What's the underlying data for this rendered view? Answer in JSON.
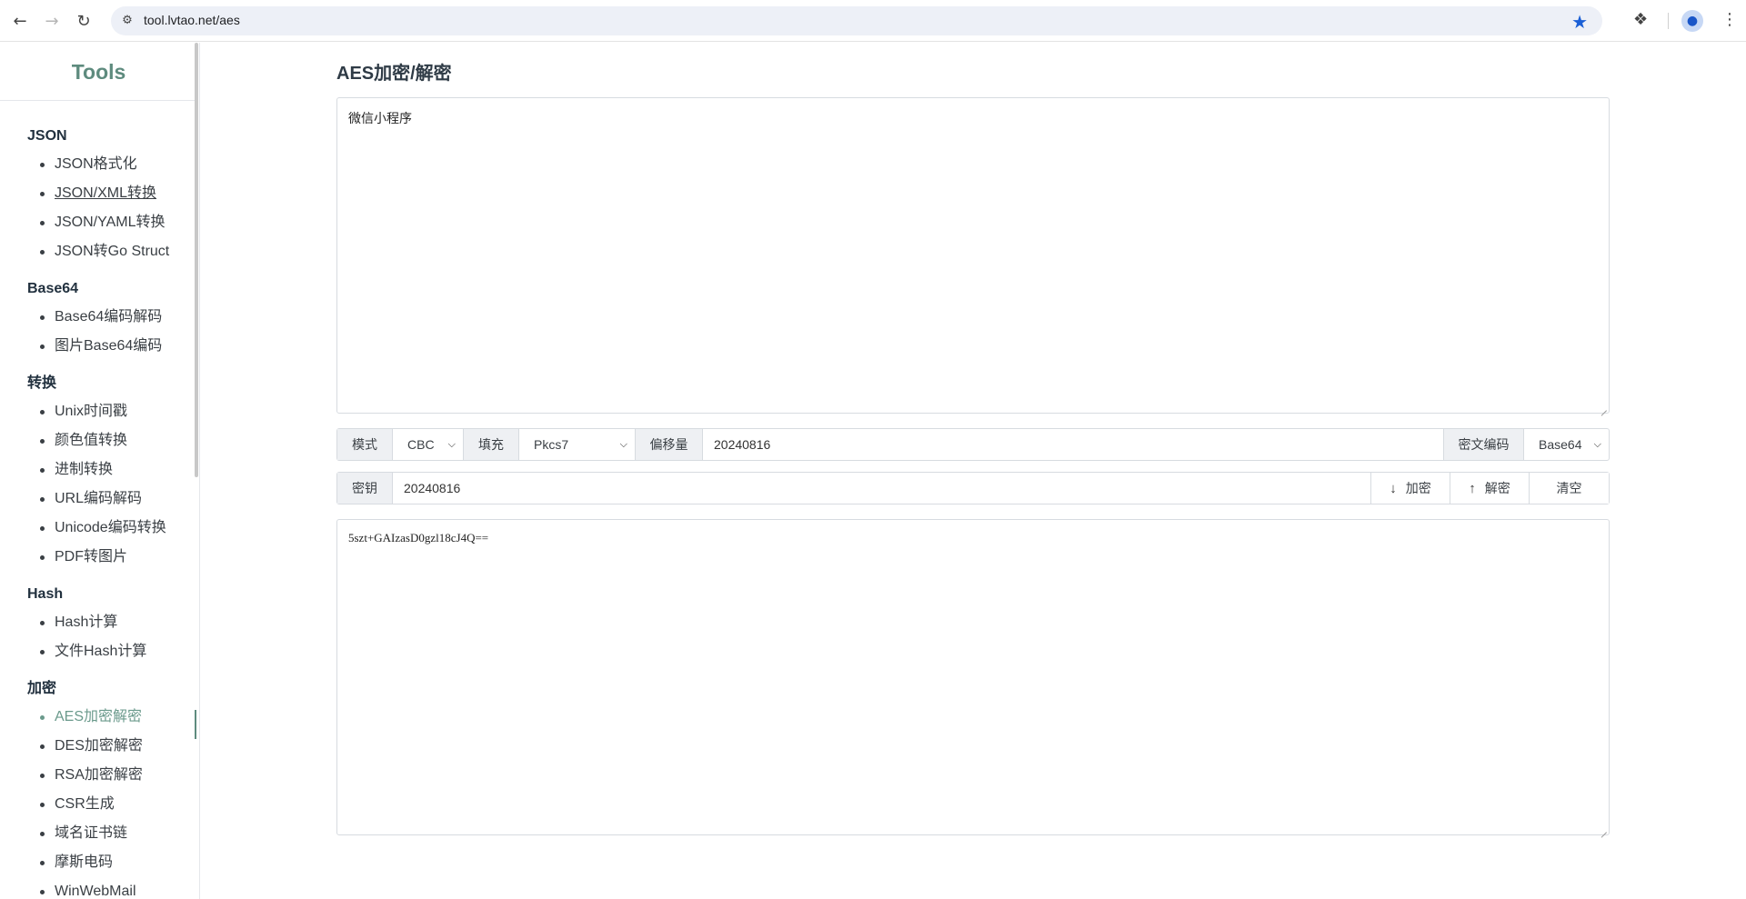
{
  "browser": {
    "url": "tool.lvtao.net/aes",
    "icons": {
      "back": "arrow-left-icon",
      "forward": "arrow-right-icon",
      "reload": "reload-icon",
      "site_info": "tune-icon",
      "bookmark": "star-icon",
      "extensions": "puzzle-icon",
      "profile": "person-icon",
      "menu": "kebab-menu-icon"
    }
  },
  "sidebar": {
    "brand": "Tools",
    "groups": [
      {
        "title": "JSON",
        "items": [
          "JSON格式化",
          "JSON/XML转换",
          "JSON/YAML转换",
          "JSON转Go Struct"
        ]
      },
      {
        "title": "Base64",
        "items": [
          "Base64编码解码",
          "图片Base64编码"
        ]
      },
      {
        "title": "转换",
        "items": [
          "Unix时间戳",
          "颜色值转换",
          "进制转换",
          "URL编码解码",
          "Unicode编码转换",
          "PDF转图片"
        ]
      },
      {
        "title": "Hash",
        "items": [
          "Hash计算",
          "文件Hash计算"
        ]
      },
      {
        "title": "加密",
        "items": [
          "AES加密解密",
          "DES加密解密",
          "RSA加密解密",
          "CSR生成",
          "域名证书链",
          "摩斯电码",
          "WinWebMail"
        ]
      }
    ]
  },
  "main": {
    "title": "AES加密/解密",
    "input_text": "微信小程序",
    "options": {
      "mode_label": "模式",
      "mode_value": "CBC",
      "padding_label": "填充",
      "padding_value": "Pkcs7",
      "iv_label": "偏移量",
      "iv_value": "20240816",
      "encoding_label": "密文编码",
      "encoding_value": "Base64"
    },
    "key": {
      "label": "密钥",
      "value": "20240816",
      "encrypt_label": "加密",
      "decrypt_label": "解密",
      "clear_label": "清空"
    },
    "output_text": "5szt+GAIzasD0gzl18cJ4Q=="
  }
}
